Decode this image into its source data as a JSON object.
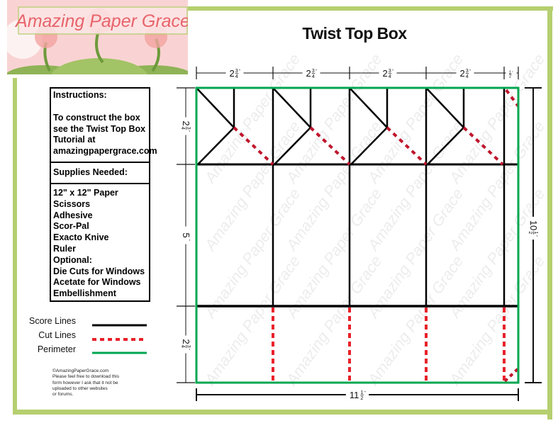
{
  "brand": {
    "logo_text": "Amazing Paper Grace"
  },
  "title": "Twist Top Box",
  "instructions": {
    "heading": "Instructions:",
    "lines": [
      "To construct the box",
      "see the Twist Top Box",
      "Tutorial at",
      "amazingpapergrace.com"
    ]
  },
  "supplies": {
    "heading": "Supplies Needed:",
    "items": [
      "12\" x 12\" Paper",
      "Scissors",
      "Adhesive",
      "Scor-Pal",
      "Exacto Knive",
      "Ruler",
      "Optional:",
      "Die Cuts for Windows",
      "Acetate for Windows",
      "Embellishment"
    ]
  },
  "legend": [
    {
      "label": "Score Lines",
      "color": "#000000",
      "style": "solid"
    },
    {
      "label": "Cut Lines",
      "color": "#e8202a",
      "style": "dashed"
    },
    {
      "label": "Perimeter",
      "color": "#00a650",
      "style": "solid"
    }
  ],
  "dimensions": {
    "top": [
      {
        "whole": "2",
        "num": "3",
        "den": "4"
      },
      {
        "whole": "2",
        "num": "3",
        "den": "4"
      },
      {
        "whole": "2",
        "num": "3",
        "den": "4"
      },
      {
        "whole": "2",
        "num": "3",
        "den": "4"
      },
      {
        "whole": "",
        "num": "1",
        "den": "2"
      }
    ],
    "left": [
      {
        "whole": "2",
        "num": "3",
        "den": "4"
      },
      {
        "whole": "5",
        "num": "",
        "den": ""
      },
      {
        "whole": "2",
        "num": "3",
        "den": "4"
      }
    ],
    "right": {
      "whole": "10",
      "num": "1",
      "den": "2"
    },
    "bottom": {
      "whole": "11",
      "num": "1",
      "den": "2"
    },
    "unit_mark": "\""
  },
  "watermark": "Amazing Paper Grace",
  "copyright": [
    "©AmazingPaperGrace.com",
    "Please feel free to download this",
    "form however I ask that it not be",
    "uploaded to other websites",
    "or forums."
  ],
  "colors": {
    "frame": "#b5cf6f",
    "perimeter": "#00a650",
    "cut_top": "#c0172d",
    "cut_bottom": "#e8202a",
    "score": "#000000",
    "logo_bg": "#f9d3d3"
  }
}
